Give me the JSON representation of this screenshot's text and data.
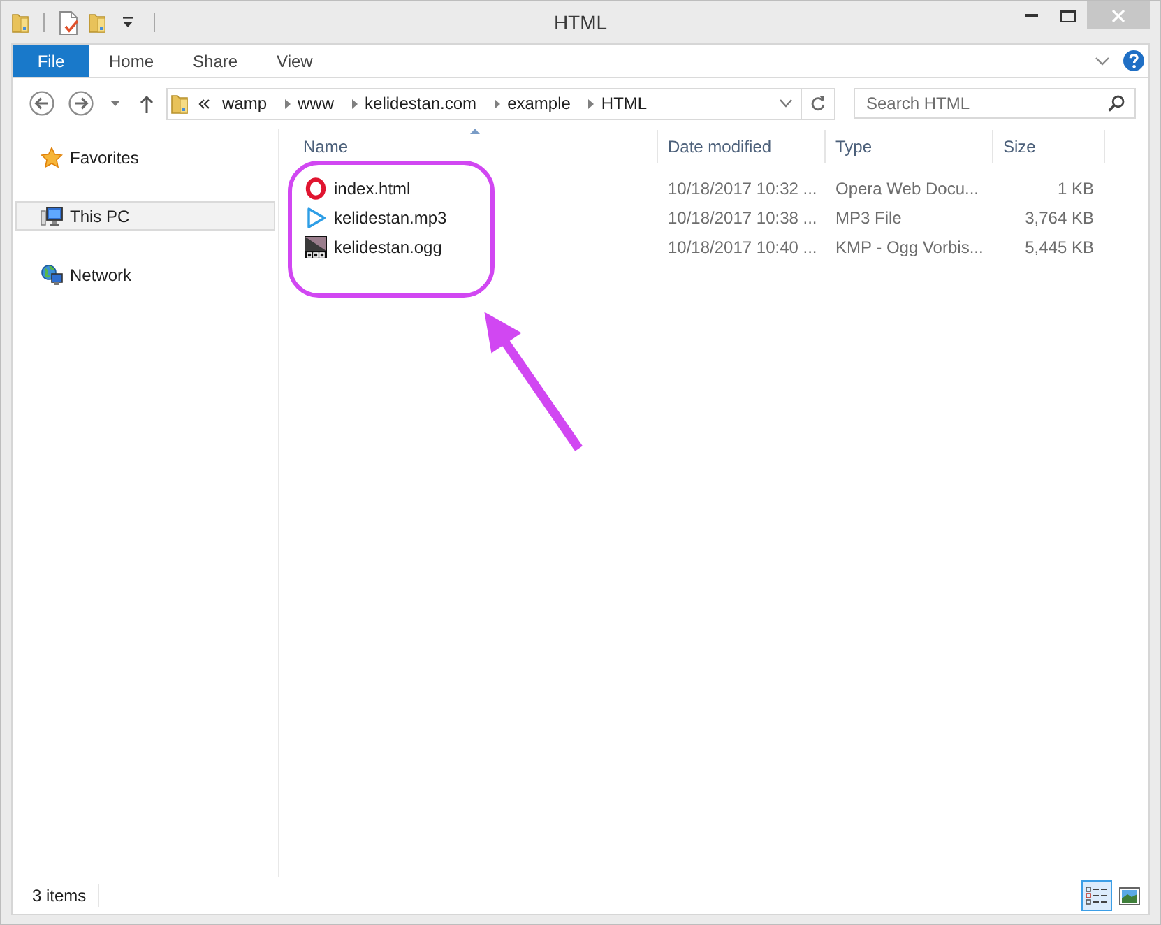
{
  "window": {
    "title": "HTML"
  },
  "ribbon": {
    "tabs": [
      {
        "label": "File",
        "kind": "file"
      },
      {
        "label": "Home",
        "kind": "tab",
        "selected": false
      },
      {
        "label": "Share",
        "kind": "tab",
        "selected": false
      },
      {
        "label": "View",
        "kind": "tab",
        "selected": false
      }
    ]
  },
  "address": {
    "segments": [
      "wamp",
      "www",
      "kelidestan.com",
      "example",
      "HTML"
    ]
  },
  "search": {
    "placeholder": "Search HTML"
  },
  "navigation": {
    "items": [
      {
        "label": "Favorites",
        "selected": false
      },
      {
        "label": "This PC",
        "selected": true
      },
      {
        "label": "Network",
        "selected": false
      }
    ]
  },
  "file_list": {
    "columns": [
      {
        "label": "Name",
        "sorted": true
      },
      {
        "label": "Date modified",
        "sorted": false
      },
      {
        "label": "Type",
        "sorted": false
      },
      {
        "label": "Size",
        "sorted": false
      }
    ],
    "rows": [
      {
        "name": "index.html",
        "date_modified": "10/18/2017 10:32 ...",
        "type": "Opera Web Docu...",
        "size": "1 KB"
      },
      {
        "name": "kelidestan.mp3",
        "date_modified": "10/18/2017 10:38 ...",
        "type": "MP3 File",
        "size": "3,764 KB"
      },
      {
        "name": "kelidestan.ogg",
        "date_modified": "10/18/2017 10:40 ...",
        "type": "KMP - Ogg Vorbis...",
        "size": "5,445 KB"
      }
    ]
  },
  "status_bar": {
    "item_count": "3 items",
    "view_buttons": [
      {
        "selected": true
      },
      {
        "selected": false
      }
    ]
  }
}
